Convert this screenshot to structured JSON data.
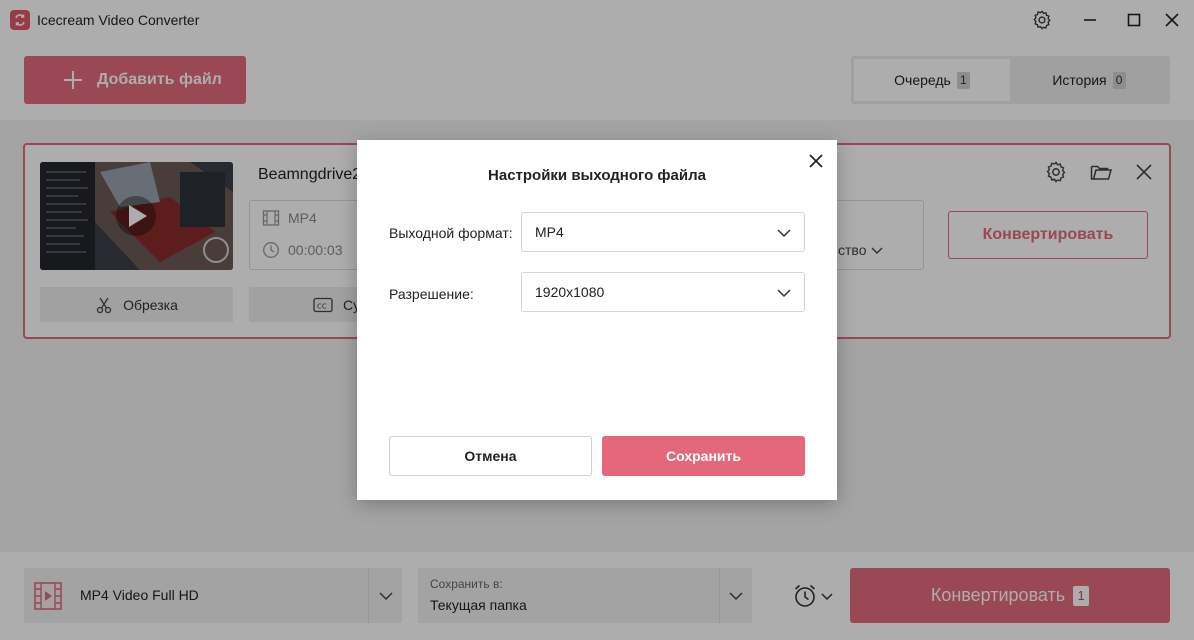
{
  "app": {
    "title": "Icecream Video Converter",
    "accent_color": "#e26a7c"
  },
  "titlebar_icons": [
    "gear-icon",
    "minimize-icon",
    "maximize-icon",
    "close-icon"
  ],
  "toolbar": {
    "add_file_label": "Добавить файл"
  },
  "tabs": [
    {
      "label": "Очередь",
      "count": "1",
      "active": true
    },
    {
      "label": "История",
      "count": "0",
      "active": false
    }
  ],
  "file_card": {
    "name": "Beamngdrive2",
    "format": "MP4",
    "duration": "00:00:03",
    "quality_partial": "ство",
    "trim_label": "Обрезка",
    "subtitles_partial": "Су",
    "convert_label": "Конвертировать"
  },
  "bottom_bar": {
    "profile_label": "MP4 Video Full HD",
    "save_to_caption": "Сохранить в:",
    "save_to_value": "Текущая папка",
    "convert_label": "Конвертировать",
    "convert_count": "1"
  },
  "dialog": {
    "title": "Настройки выходного файла",
    "format_label": "Выходной формат:",
    "format_value": "MP4",
    "resolution_label": "Разрешение:",
    "resolution_value": "1920x1080",
    "cancel_label": "Отмена",
    "save_label": "Сохранить"
  }
}
